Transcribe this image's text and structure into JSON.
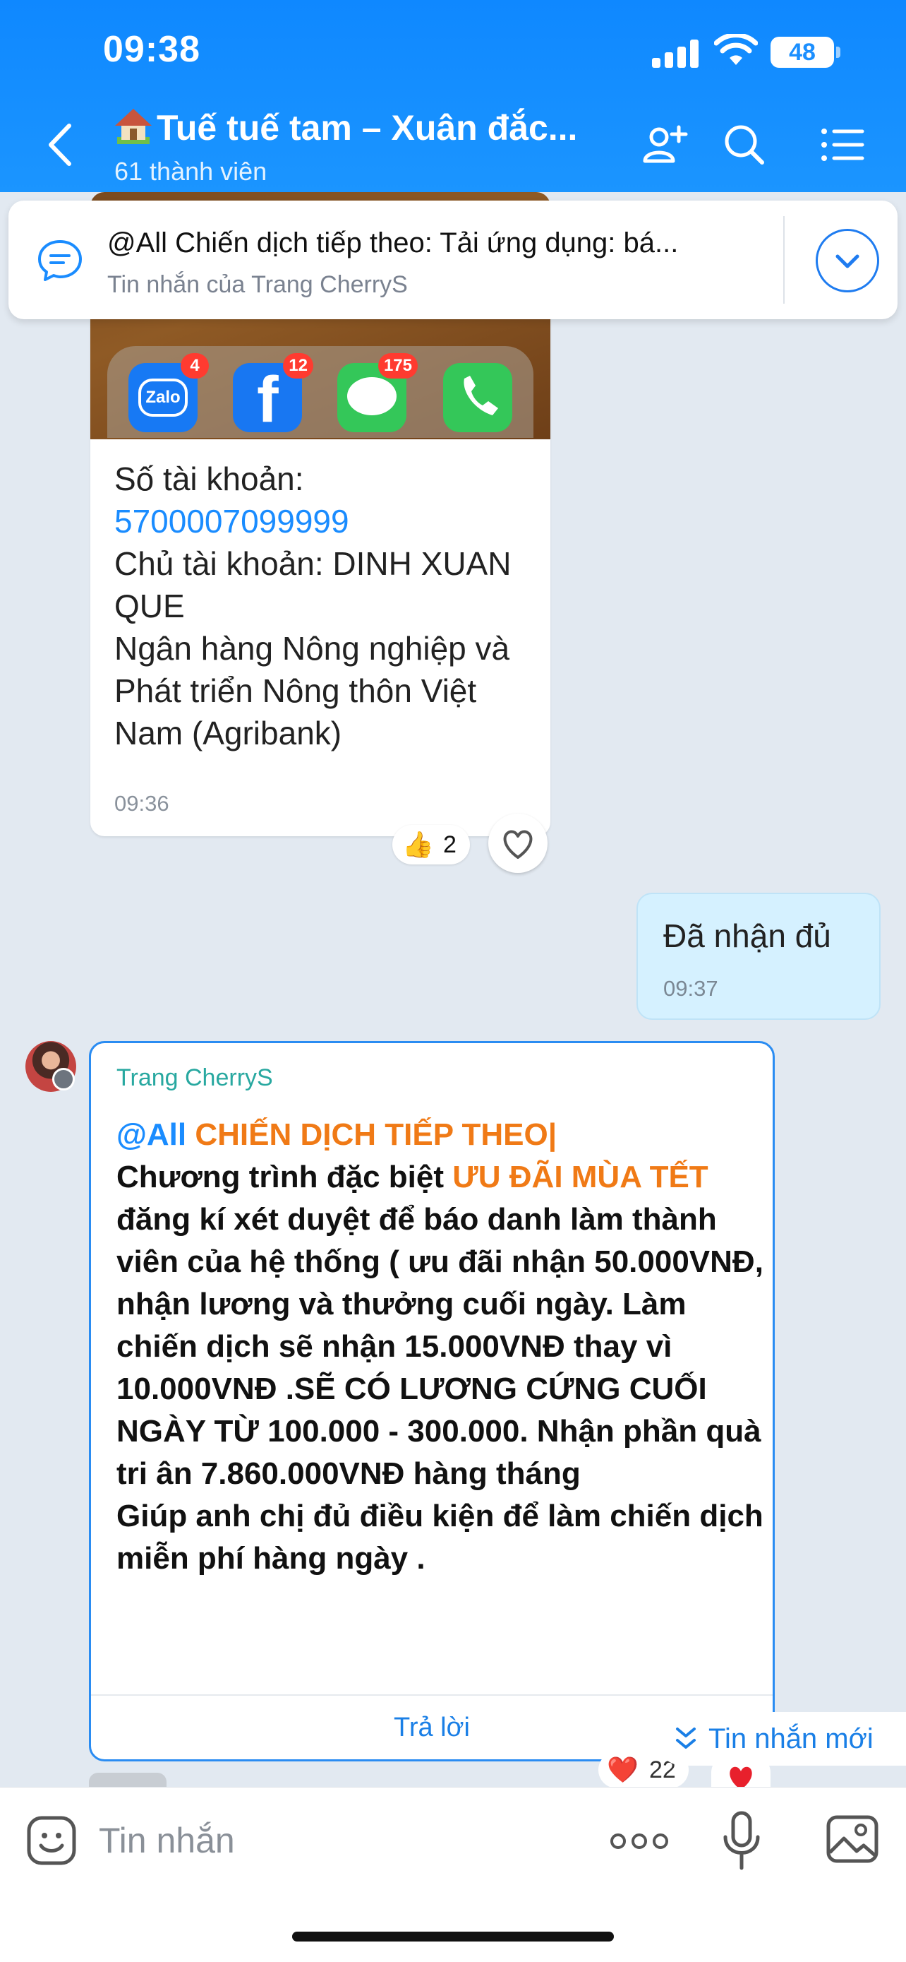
{
  "status_bar": {
    "time": "09:38",
    "battery": "48"
  },
  "header": {
    "title": "Tuế tuế tam – Xuân đắc...",
    "member_count": "61 thành viên",
    "icons": [
      "back-icon",
      "add-member-icon",
      "search-icon",
      "menu-icon"
    ]
  },
  "pinned": {
    "text": "@All Chiến dịch tiếp theo: Tải ứng dụng: bá...",
    "sub": "Tin nhắn của Trang CherryS"
  },
  "bank_card": {
    "apps": [
      {
        "name": "Zalo",
        "badge": "4"
      },
      {
        "name": "Facebook",
        "badge": "12"
      },
      {
        "name": "Messages",
        "badge": "175"
      },
      {
        "name": "Phone",
        "badge": ""
      }
    ],
    "label_account": "Số tài khoản:",
    "account_number": "5700007099999",
    "owner": "Chủ tài khoản: DINH XUAN QUE",
    "bank": "Ngân hàng Nông nghiệp và Phát triển Nông thôn Việt Nam (Agribank)",
    "time": "09:36",
    "reaction_count": "2"
  },
  "own_message": {
    "text": "Đã nhận đủ",
    "time": "09:37"
  },
  "trang_message": {
    "sender": "Trang CherryS",
    "mention": "@All",
    "heading": "CHIẾN DỊCH TIẾP THEO|",
    "line_a": "Chương trình đặc biệt",
    "highlight": "ƯU ĐÃI MÙA TẾT",
    "line_b": "đăng kí xét duyệt để báo danh làm thành viên của hệ thống ( ưu đãi nhận 50.000VNĐ, nhận lương và thưởng cuối ngày. Làm chiến dịch sẽ nhận 15.000VNĐ thay vì 10.000VNĐ .SẼ CÓ LƯƠNG CỨNG CUỐI NGÀY TỪ 100.000 - 300.000. Nhận phần quà tri ân 7.860.000VNĐ hàng tháng",
    "line_c": "Giúp anh chị đủ điều kiện để làm chiến dịch miễn phí hàng ngày .",
    "reply_label": "Trả lời",
    "reaction_count": "22"
  },
  "new_messages_label": "Tin nhắn mới",
  "input": {
    "placeholder": "Tin nhắn"
  },
  "colors": {
    "header": "#1b95ff",
    "accent": "#1a8cff",
    "highlight": "#f07a16",
    "own_bubble": "#d5f1ff"
  }
}
